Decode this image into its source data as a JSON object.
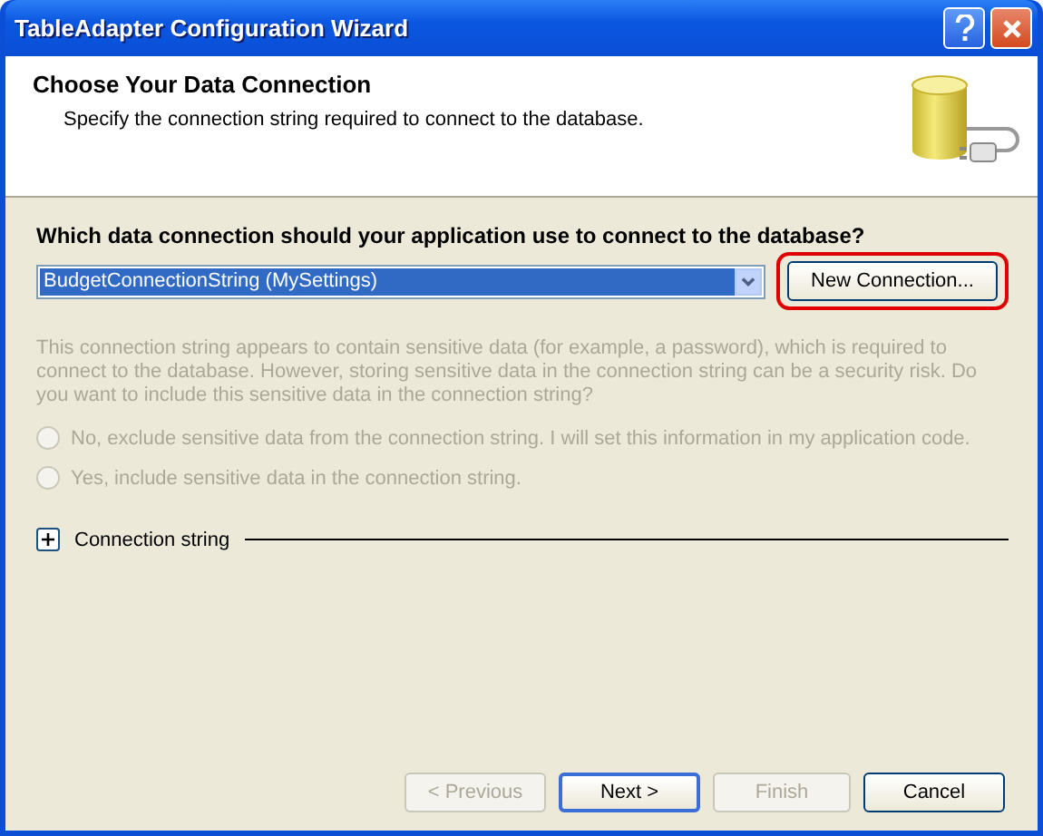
{
  "window": {
    "title": "TableAdapter Configuration Wizard"
  },
  "header": {
    "title": "Choose Your Data Connection",
    "subtitle": "Specify the connection string required to connect to the database."
  },
  "question": "Which data connection should your application use to connect to the database?",
  "connection": {
    "value": "BudgetConnectionString (MySettings)"
  },
  "new_connection_button": {
    "label": "New Connection...",
    "highlighted": true
  },
  "sensitive": {
    "disabled": true,
    "text": "This connection string appears to contain sensitive data (for example, a password), which is required to connect to the database. However, storing sensitive data in the connection string can be a security risk. Do you want to include this sensitive data in the connection string?",
    "options": [
      {
        "label": "No, exclude sensitive data from the connection string. I will set this information in my application code.",
        "selected": false
      },
      {
        "label": "Yes, include sensitive data in the connection string.",
        "selected": false
      }
    ]
  },
  "expander": {
    "label": "Connection string",
    "expanded": false
  },
  "buttons": [
    {
      "label": "< Previous",
      "disabled": true,
      "default": false
    },
    {
      "label": "Next >",
      "disabled": false,
      "default": true
    },
    {
      "label": "Finish",
      "disabled": true,
      "default": false
    },
    {
      "label": "Cancel",
      "disabled": false,
      "default": false
    }
  ]
}
